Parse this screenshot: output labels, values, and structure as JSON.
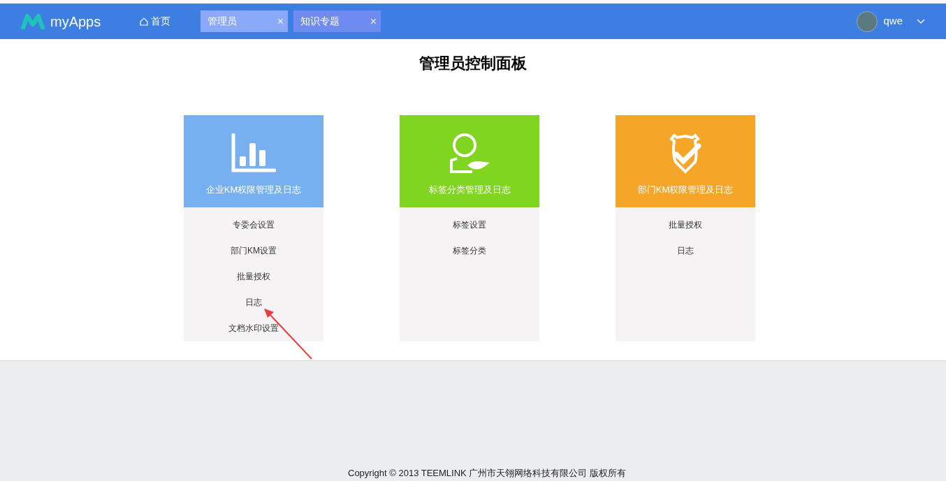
{
  "header": {
    "logo_text": "myApps",
    "home": "首页",
    "tabs": [
      {
        "label": "管理员",
        "close": "×",
        "selected": true
      },
      {
        "label": "知识专题",
        "close": "×",
        "selected": false
      }
    ],
    "user": {
      "name": "qwe"
    }
  },
  "page_title": "管理员控制面板",
  "cards": [
    {
      "kind": "chart",
      "title": "企业KM权限管理及日志",
      "color": "#77b0f1",
      "links": [
        "专委会设置",
        "部门KM设置",
        "批量授权",
        "日志",
        "文档水印设置"
      ]
    },
    {
      "kind": "person",
      "title": "标签分类管理及日志",
      "color": "#80d521",
      "links": [
        "标签设置",
        "标签分类"
      ]
    },
    {
      "kind": "shield",
      "title": "部门KM权限管理及日志",
      "color": "#f5a627",
      "links": [
        "批量授权",
        "日志"
      ]
    }
  ],
  "footer": "Copyright © 2013 TEEMLINK 广州市天翎网络科技有限公司 版权所有"
}
